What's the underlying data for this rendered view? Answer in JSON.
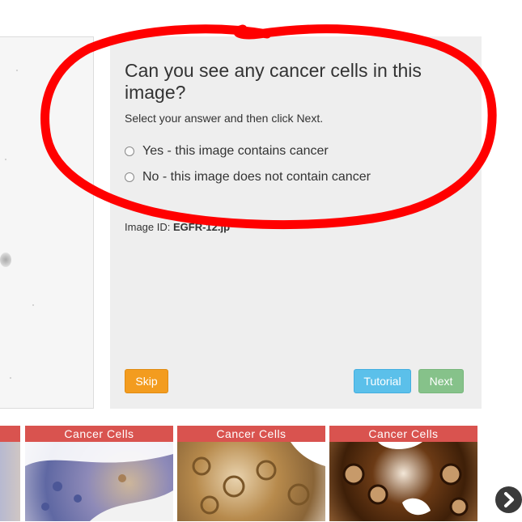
{
  "question": {
    "title": "Can you see any cancer cells in this image?",
    "instructions": "Select your answer and then click Next.",
    "options": [
      {
        "label": "Yes - this image contains cancer",
        "selected": false
      },
      {
        "label": "No - this image does not contain cancer",
        "selected": false
      }
    ]
  },
  "image_info": {
    "prefix": "Image ID:",
    "id": "EGFR-12.jp"
  },
  "buttons": {
    "skip": "Skip",
    "tutorial": "Tutorial",
    "next": "Next"
  },
  "thumbnails": [
    {
      "label": ""
    },
    {
      "label": "Cancer Cells"
    },
    {
      "label": "Cancer Cells"
    },
    {
      "label": "Cancer Cells"
    }
  ],
  "colors": {
    "skip": "#f39c1f",
    "tutorial": "#5bc0ea",
    "next": "#86c28a",
    "annotation": "#ff0000",
    "thumb_label": "#d9534f"
  },
  "icons": {
    "next_page": "chevron-right-icon"
  }
}
